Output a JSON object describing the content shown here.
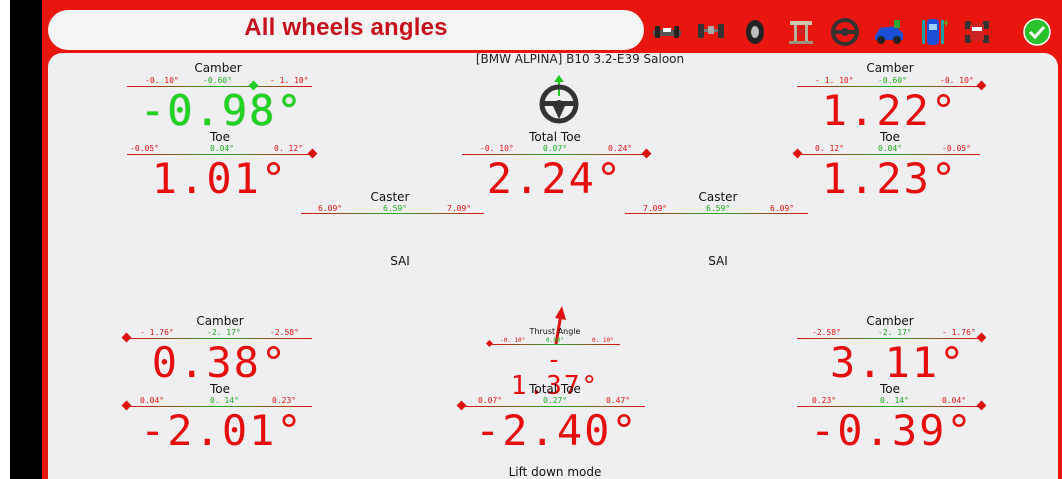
{
  "title": "All wheels angles",
  "vehicle": "[BMW ALPINA] B10 3.2-E39 Saloon",
  "colors": {
    "frame": "#e8160f",
    "panel": "#efeff2",
    "red_value": "#e60d0d",
    "green_value": "#1fd41f"
  },
  "toolbar": [
    {
      "icon": "vehicle-front-icon"
    },
    {
      "icon": "axle-icon"
    },
    {
      "icon": "tire-icon"
    },
    {
      "icon": "lift-icon"
    },
    {
      "icon": "steering-wheel-icon"
    },
    {
      "icon": "car-sensor-icon"
    },
    {
      "icon": "car-top-icon"
    },
    {
      "icon": "alignment-car-icon"
    },
    {
      "icon": "confirm-check-icon"
    }
  ],
  "front_left": {
    "camber": {
      "label": "Camber",
      "min": "-0. 10°",
      "mid": "-0.60°",
      "max": "- 1. 10°",
      "value": "-0.98°"
    },
    "toe": {
      "label": "Toe",
      "min": "-0.05°",
      "mid": "0.04°",
      "max": "0. 12°",
      "value": "1.01°"
    },
    "caster": {
      "label": "Caster",
      "min": "6.09°",
      "mid": "6.59°",
      "max": "7.09°"
    },
    "sai": {
      "label": "SAI"
    }
  },
  "front_right": {
    "camber": {
      "label": "Camber",
      "min": "- 1. 10°",
      "mid": "-0.60°",
      "max": "-0. 10°",
      "value": "1.22°"
    },
    "toe": {
      "label": "Toe",
      "min": "0. 12°",
      "mid": "0.04°",
      "max": "-0.05°",
      "value": "1.23°"
    },
    "caster": {
      "label": "Caster",
      "min": "7.09°",
      "mid": "6.59°",
      "max": "6.09°"
    },
    "sai": {
      "label": "SAI"
    }
  },
  "front_total_toe": {
    "label": "Total Toe",
    "min": "-0. 10°",
    "mid": "0.07°",
    "max": "0.24°",
    "value": "2.24°"
  },
  "rear_left": {
    "camber": {
      "label": "Camber",
      "min": "- 1.76°",
      "mid": "-2. 17°",
      "max": "-2.58°",
      "value": "0.38°"
    },
    "toe": {
      "label": "Toe",
      "min": "0.04°",
      "mid": "0. 14°",
      "max": "0.23°",
      "value": "-2.01°"
    }
  },
  "rear_right": {
    "camber": {
      "label": "Camber",
      "min": "-2.58°",
      "mid": "-2. 17°",
      "max": "- 1.76°",
      "value": "3.11°"
    },
    "toe": {
      "label": "Toe",
      "min": "0.23°",
      "mid": "0. 14°",
      "max": "0.04°",
      "value": "-0.39°"
    }
  },
  "thrust_angle": {
    "label": "Thrust Angle",
    "min": "-0. 10°",
    "mid": "0.00°",
    "max": "0. 10°",
    "value": "- 1.37°"
  },
  "rear_total_toe": {
    "label": "Total Toe",
    "min": "0.07°",
    "mid": "0.27°",
    "max": "0.47°",
    "value": "-2.40°"
  },
  "mode": "Lift down mode"
}
